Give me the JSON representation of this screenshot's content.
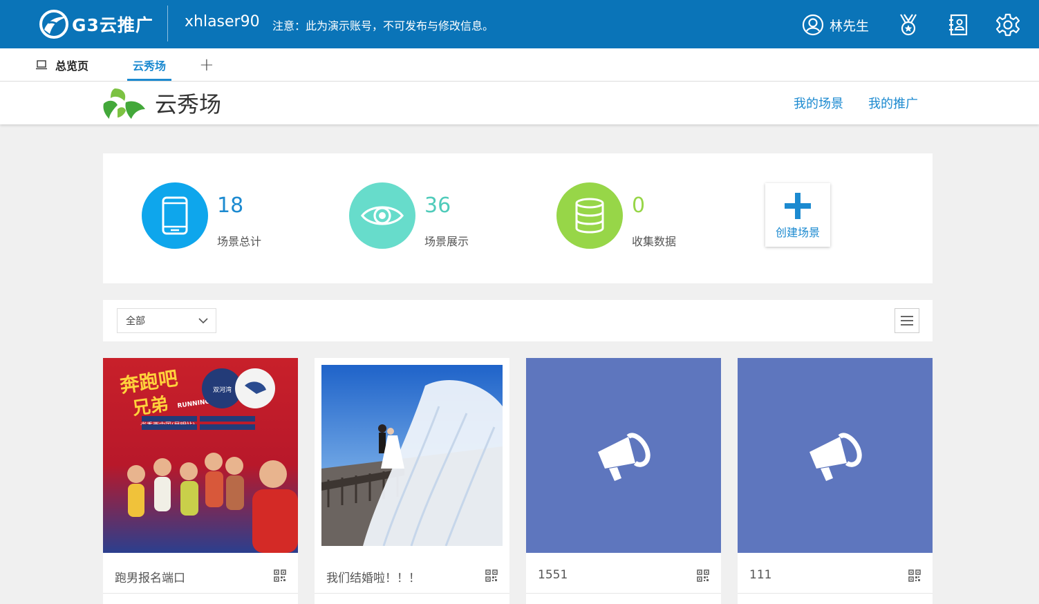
{
  "header": {
    "logo_text": "G3云推广",
    "account": "xhlaser90",
    "notice": "注意：此为演示账号，不可发布与修改信息。",
    "user_name": "林先生"
  },
  "tabs": {
    "home": "总览页",
    "active": "云秀场",
    "add": "+"
  },
  "app": {
    "title": "云秀场",
    "links": [
      "我的场景",
      "我的推广"
    ]
  },
  "stats": [
    {
      "value": "18",
      "label": "场景总计",
      "color": "#0ea6ec"
    },
    {
      "value": "36",
      "label": "场景展示",
      "color": "#67dccb"
    },
    {
      "value": "0",
      "label": "收集数据",
      "color": "#97d648"
    }
  ],
  "create_label": "创建场景",
  "filter": {
    "selected": "全部"
  },
  "cards": [
    {
      "title": "跑男报名端口",
      "poster_lines": [
        "奔跑吧",
        "兄弟",
        "RUNNING MAN",
        "书香西中国(昆明站)",
        "双河湾"
      ]
    },
    {
      "title": "我们结婚啦！！！"
    },
    {
      "title": "1551"
    },
    {
      "title": "111"
    }
  ],
  "colors": {
    "primary": "#0a74b8",
    "accent": "#1c8ad0",
    "placeholder": "#5e76be"
  }
}
